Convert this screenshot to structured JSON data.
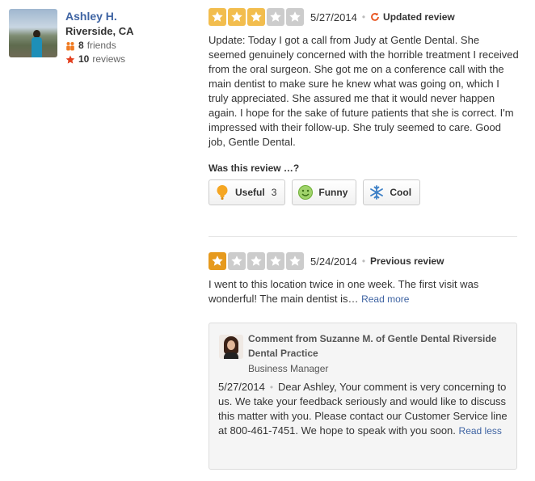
{
  "user": {
    "name": "Ashley H.",
    "location": "Riverside, CA",
    "friends_count": "8",
    "friends_label": "friends",
    "reviews_count": "10",
    "reviews_label": "reviews"
  },
  "review_current": {
    "rating": 3,
    "rating_max": 5,
    "date": "5/27/2014",
    "status": "Updated review",
    "text": "Update: Today I got a call from Judy at Gentle Dental. She seemed genuinely concerned with the horrible treatment I received from the oral surgeon. She got me on a conference call with the main dentist to make sure he knew what was going on, which I truly appreciated. She assured me that it would never happen again. I hope for the sake of future patients that she is correct.  I'm impressed with their follow-up. She truly seemed to care.  Good job, Gentle Dental.",
    "feedback_label": "Was this review …?",
    "buttons": {
      "useful_label": "Useful",
      "useful_count": "3",
      "funny_label": "Funny",
      "cool_label": "Cool"
    }
  },
  "review_previous": {
    "rating": 1,
    "rating_max": 5,
    "date": "5/24/2014",
    "status": "Previous review",
    "text": "I went to this location twice in one week.  The first visit was wonderful! The main dentist is…",
    "read_more": "Read more"
  },
  "owner_comment": {
    "title": "Comment from Suzanne M. of Gentle Dental Riverside Dental Practice",
    "role": "Business Manager",
    "date": "5/27/2014",
    "text": "Dear Ashley, Your comment is very concerning to us.  We take your feedback seriously and would like to discuss this matter with you.  Please contact our Customer Service line at 800-461-7451. We hope to speak with you soon.",
    "read_less": "Read less"
  },
  "colors": {
    "link": "#3f64a3",
    "star_on": "#f2bd4e",
    "star_low": "#e69a1e",
    "star_off": "#cccccc",
    "update_icon": "#e8531e"
  },
  "icons": {
    "friends": "friends-icon",
    "reviews": "star-icon",
    "updated": "refresh-icon",
    "useful": "lightbulb-icon",
    "funny": "smiley-icon",
    "cool": "snowflake-icon"
  }
}
